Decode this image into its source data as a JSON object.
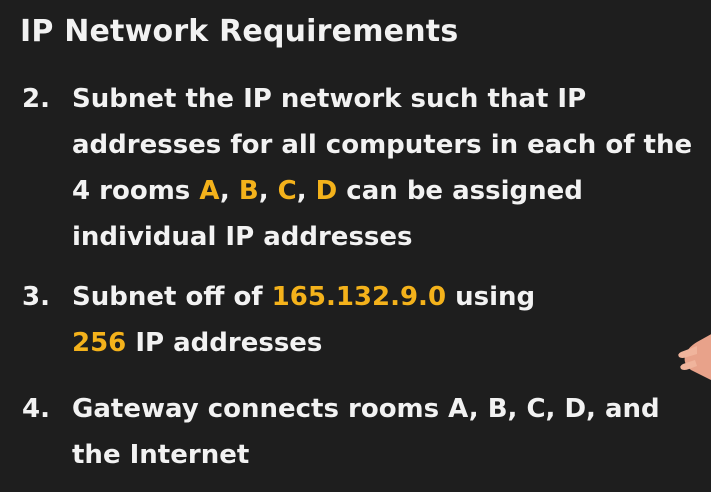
{
  "title": "IP Network Requirements",
  "colors": {
    "background": "#1e1e1e",
    "text": "#f2f2f2",
    "highlight": "#f4b21b"
  },
  "requirements": [
    {
      "number": "2.",
      "lines": [
        [
          {
            "text": "Subnet the IP network such that IP",
            "hl": false
          }
        ],
        [
          {
            "text": "addresses for all computers in each of the",
            "hl": false
          }
        ],
        [
          {
            "text": "4 rooms ",
            "hl": false
          },
          {
            "text": "A",
            "hl": true
          },
          {
            "text": ", ",
            "hl": false
          },
          {
            "text": "B",
            "hl": true
          },
          {
            "text": ", ",
            "hl": false
          },
          {
            "text": "C",
            "hl": true
          },
          {
            "text": ", ",
            "hl": false
          },
          {
            "text": "D",
            "hl": true
          },
          {
            "text": " can be assigned",
            "hl": false
          }
        ],
        [
          {
            "text": "individual IP addresses",
            "hl": false
          }
        ]
      ]
    },
    {
      "number": "3.",
      "lines": [
        [
          {
            "text": "Subnet off of ",
            "hl": false
          },
          {
            "text": "165.132.9.0",
            "hl": true
          },
          {
            "text": " using",
            "hl": false
          }
        ],
        [
          {
            "text": "256",
            "hl": true
          },
          {
            "text": " IP addresses",
            "hl": false
          }
        ]
      ]
    },
    {
      "number": "4.",
      "lines": [
        [
          {
            "text": "Gateway connects rooms A, B, C, D, and",
            "hl": false
          }
        ],
        [
          {
            "text": "the Internet",
            "hl": false
          }
        ]
      ]
    }
  ],
  "decor": {
    "hand_icon": "pointing-hand-icon"
  }
}
